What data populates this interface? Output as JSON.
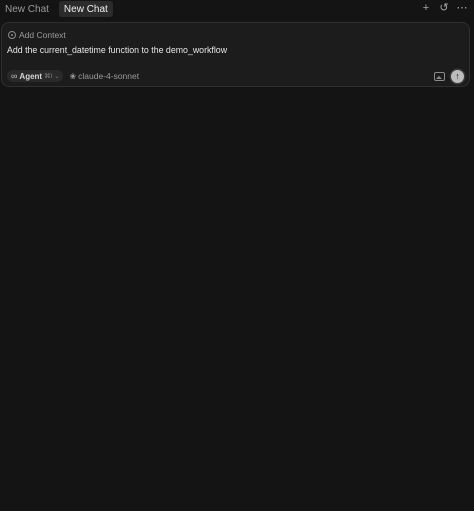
{
  "tabs": [
    {
      "label": "New Chat",
      "active": false
    },
    {
      "label": "New Chat",
      "active": true
    }
  ],
  "tab_actions": {
    "new_icon": "+",
    "history_icon": "↺",
    "more_icon": "⋯"
  },
  "composer": {
    "add_context_label": "Add Context",
    "prompt_text": "Add the current_datetime function to the demo_workflow",
    "mode": {
      "icon": "∞",
      "label": "Agent",
      "shortcut": "⌘I",
      "caret": "⌄"
    },
    "model": {
      "icon": "❀",
      "label": "claude-4-sonnet"
    },
    "send_icon": "↑"
  },
  "colors": {
    "background": "#141414",
    "composer_bg": "#1c1c1c",
    "send_button": "#bdbdbd"
  }
}
